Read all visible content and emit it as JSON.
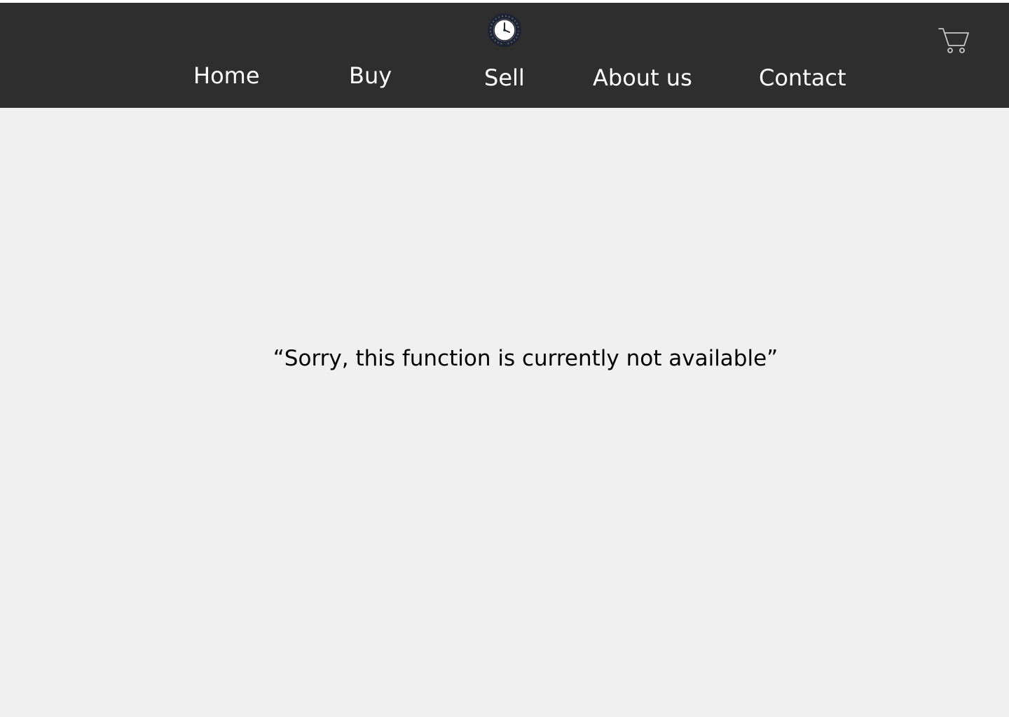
{
  "header": {
    "logo_icon": "clock-icon",
    "nav": {
      "home": "Home",
      "buy": "Buy",
      "sell": "Sell",
      "about": "About us",
      "contact": "Contact"
    },
    "cart_icon": "cart-icon"
  },
  "main": {
    "message": "“Sorry, this function is currently not available”"
  },
  "colors": {
    "header_bg": "#2e2e2e",
    "page_bg": "#f0f0f0",
    "nav_text": "#ffffff",
    "message_text": "#000000"
  }
}
